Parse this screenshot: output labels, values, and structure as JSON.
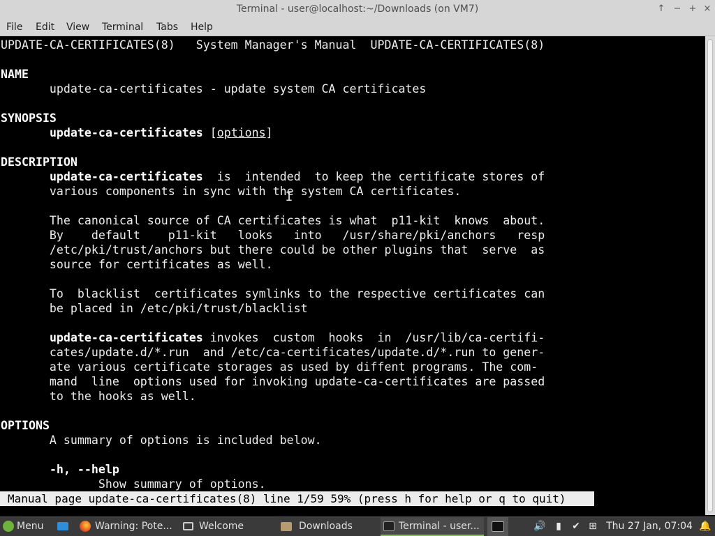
{
  "window": {
    "title": "Terminal - user@localhost:~/Downloads (on VM7)",
    "buttons": {
      "pin": "↑",
      "minimize": "−",
      "maximize": "+",
      "close": "×"
    }
  },
  "menubar": [
    "File",
    "Edit",
    "View",
    "Terminal",
    "Tabs",
    "Help"
  ],
  "man_page": {
    "header": "UPDATE-CA-CERTIFICATES(8)   System Manager's Manual  UPDATE-CA-CERTIFICATES(8)",
    "name_heading": "NAME",
    "name_line": "       update-ca-certificates - update system CA certificates",
    "synopsis_heading": "SYNOPSIS",
    "synopsis_indent": "       ",
    "synopsis_cmd": "update-ca-certificates",
    "synopsis_gap": " [",
    "synopsis_opt": "options",
    "synopsis_close": "]",
    "description_heading": "DESCRIPTION",
    "indent": "       ",
    "desc1_cmd": "update-ca-certificates",
    "desc1_rest": "  is  intended  to keep the certificate stores of",
    "desc2": "       various components in sync with the system CA certificates.",
    "desc3": "       The canonical source of CA certificates is what  p11-kit  knows  about.",
    "desc4": "       By    default    p11-kit   looks   into   /usr/share/pki/anchors   resp",
    "desc5": "       /etc/pki/trust/anchors but there could be other plugins that  serve  as",
    "desc6": "       source for certificates as well.",
    "desc7": "       To  blacklist  certificates symlinks to the respective certificates can",
    "desc8": "       be placed in /etc/pki/trust/blacklist",
    "desc9_cmd": "update-ca-certificates",
    "desc9_rest": " invokes  custom  hooks  in  /usr/lib/ca-certifi‐",
    "desc10": "       cates/update.d/*.run  and /etc/ca-certificates/update.d/*.run to gener‐",
    "desc11": "       ate various certificate storages as used by diffent programs. The com‐",
    "desc12": "       mand  line  options used for invoking update-ca-certificates are passed",
    "desc13": "       to the hooks as well.",
    "options_heading": "OPTIONS",
    "opt_summary": "       A summary of options is included below.",
    "opt_help_flag": "-h, --help",
    "opt_help_desc": "              Show summary of options."
  },
  "status_line": "Manual page update-ca-certificates(8) line 1/59 59% (press h for help or q to quit)",
  "taskbar": {
    "menu_label": "Menu",
    "items": [
      {
        "label": "Warning: Pote...",
        "icon": "firefox-icon"
      },
      {
        "label": "Welcome",
        "icon": "window-icon"
      },
      {
        "label": "Downloads",
        "icon": "folder-icon"
      },
      {
        "label": "Terminal - user...",
        "icon": "terminal-icon",
        "active": true
      }
    ],
    "clock": "Thu 27 Jan, 07:04"
  },
  "colors": {
    "terminal_bg": "#000000",
    "terminal_fg": "#ececec",
    "chrome": "#d6d6d6",
    "taskbar": "#3a3a3a",
    "accent": "#7fbf4f"
  }
}
